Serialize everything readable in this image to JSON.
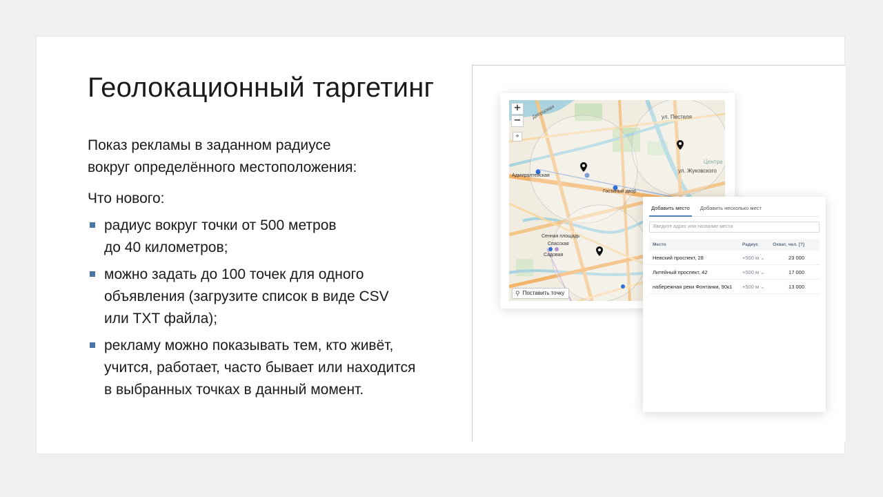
{
  "title": "Геолокационный таргетинг",
  "lead": [
    "Показ рекламы в заданном радиусе",
    "вокруг определённого местоположения:"
  ],
  "subhead": "Что нового:",
  "bullets": [
    [
      "радиус вокруг точки от 500 метров",
      "до 40 километров;"
    ],
    [
      "можно задать до 100 точек для одного",
      "объявления (загрузите список в виде CSV",
      "или TXT файла);"
    ],
    [
      "рекламу можно показывать тем, кто живёт,",
      "учится, работает, часто бывает или находится",
      "в выбранных точках в данный момент."
    ]
  ],
  "colors": {
    "accent": "#4a76a8",
    "tab_underline": "#5181b8",
    "map_water": "#a9d3df",
    "map_road": "#f2b36a",
    "map_park": "#cfe2bf"
  },
  "map": {
    "zoom_in": "+",
    "zoom_out": "−",
    "locate_icon": "location-icon",
    "place_button": "Поставить точку",
    "labels": {
      "ul_pestelya": "ул. Пестеля",
      "dvortsovaya": "Дворцовая",
      "admiralteyskaya": "Адмиралтейская",
      "gostiny_dvor": "Гостиный двор",
      "sennaya": "Сенная площадь",
      "spasskaya": "Спасская",
      "sadovaya": "Садовая",
      "zhukovskogo": "ул. Жуковского",
      "tsentr": "Центра"
    }
  },
  "panel": {
    "tabs": [
      "Добавить место",
      "Добавить несколько мест"
    ],
    "search_placeholder": "Введите адрес или название места",
    "columns": [
      "Место",
      "Радиус",
      "Охват, чел. [?]"
    ],
    "rows": [
      {
        "place": "Невский проспект, 28",
        "radius": "+500 м",
        "reach": "23 000"
      },
      {
        "place": "Литейный проспект, 42",
        "radius": "+500 м",
        "reach": "17 000"
      },
      {
        "place": "набережная реки Фонтанки, 90к1",
        "radius": "+500 м",
        "reach": "13 000"
      }
    ]
  }
}
